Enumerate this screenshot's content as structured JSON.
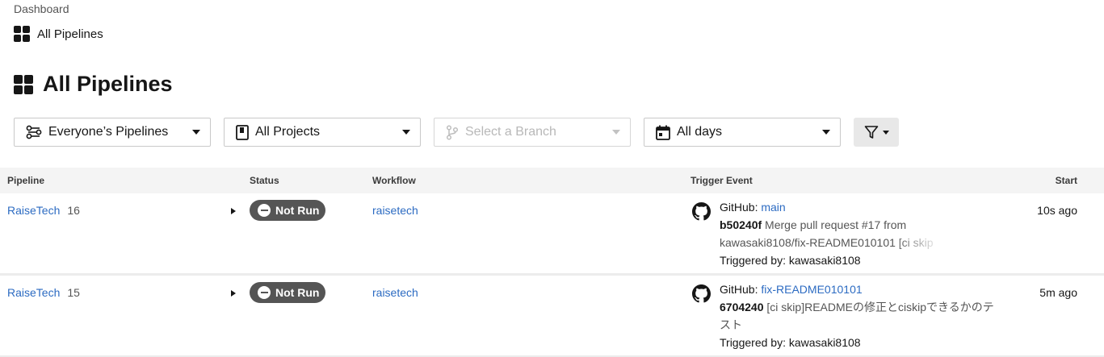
{
  "breadcrumb": {
    "parent": "Dashboard",
    "current": "All Pipelines"
  },
  "page": {
    "title": "All Pipelines"
  },
  "filters": {
    "pipelines": "Everyone’s Pipelines",
    "projects": "All Projects",
    "branch_placeholder": "Select a Branch",
    "days": "All days"
  },
  "table": {
    "headers": {
      "pipeline": "Pipeline",
      "status": "Status",
      "workflow": "Workflow",
      "trigger": "Trigger Event",
      "start": "Start"
    },
    "rows": [
      {
        "pipeline": "RaiseTech",
        "number": "16",
        "status": "Not Run",
        "workflow": "raisetech",
        "source": "GitHub: ",
        "branch": "main",
        "sha": "b50240f",
        "message": "Merge pull request #17 from",
        "message_cont": "kawasaki8108/fix-README010101",
        "message_fade": " [ci skip",
        "triggered_by": "Triggered by: kawasaki8108",
        "start": "10s ago"
      },
      {
        "pipeline": "RaiseTech",
        "number": "15",
        "status": "Not Run",
        "workflow": "raisetech",
        "source": "GitHub: ",
        "branch": "fix-README010101",
        "sha": "6704240",
        "message": "[ci skip]READMEの修正とciskipできるかのテ",
        "message_cont": "スト",
        "triggered_by": "Triggered by: kawasaki8108",
        "start": "5m ago"
      }
    ]
  },
  "colors": {
    "link": "#2c6bc2",
    "status_badge": "#555555",
    "header_bg": "#f4f4f4"
  }
}
